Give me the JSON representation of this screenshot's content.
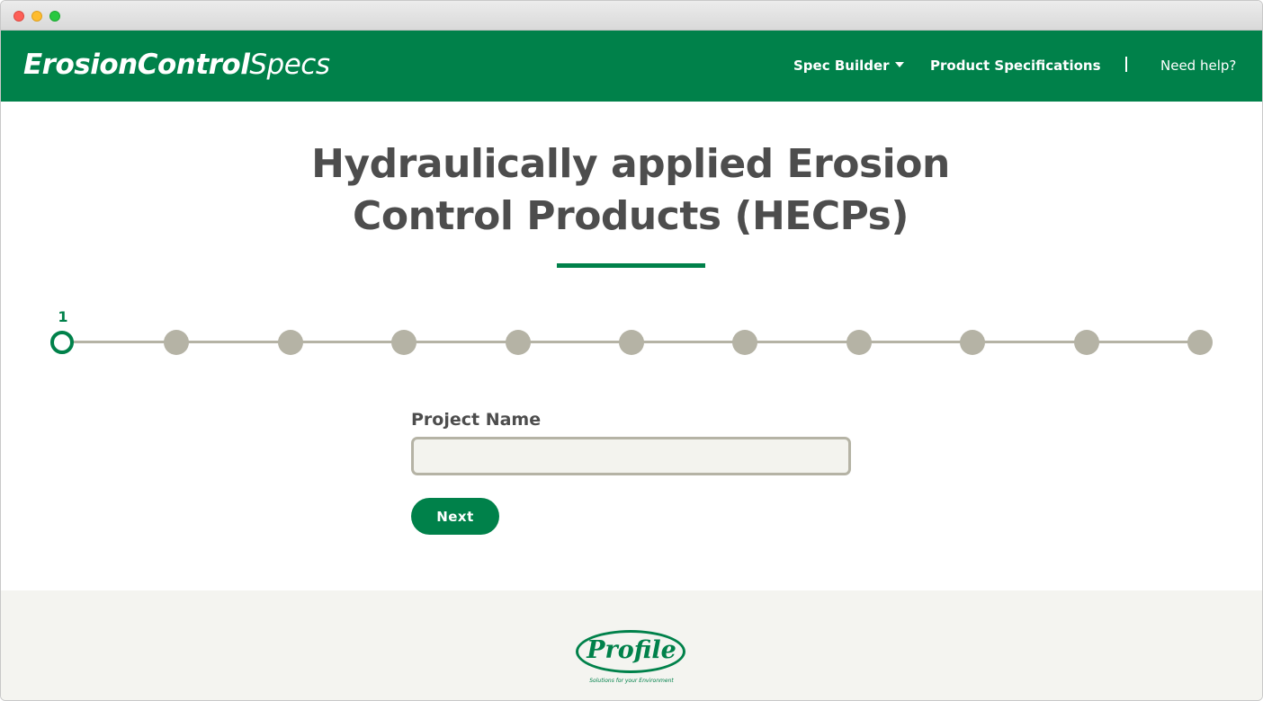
{
  "header": {
    "logo_part1": "ErosionControl",
    "logo_part2": "Specs",
    "nav": {
      "spec_builder": "Spec Builder",
      "product_specifications": "Product Specifications",
      "need_help": "Need help?"
    }
  },
  "main": {
    "title": "Hydraulically applied Erosion Control Products (HECPs)",
    "stepper": {
      "current_step_label": "1",
      "total_steps": 11,
      "current_step": 1
    },
    "form": {
      "project_name_label": "Project Name",
      "project_name_value": "",
      "next_label": "Next"
    }
  },
  "footer": {
    "brand_name": "Profile",
    "brand_tagline": "Solutions for your Environment"
  },
  "colors": {
    "brand_green": "#00814a",
    "step_inactive": "#b5b3a5",
    "text_dark": "#4d4d4d",
    "footer_bg": "#f4f4f0"
  }
}
